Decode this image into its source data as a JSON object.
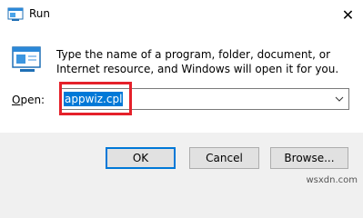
{
  "window": {
    "title": "Run",
    "close_symbol": "✕"
  },
  "icons": {
    "app": "run-icon",
    "close": "close-icon",
    "dropdown": "chevron-down-icon"
  },
  "description": "Type the name of a program, folder, document, or Internet resource, and Windows will open it for you.",
  "open": {
    "label_accel": "O",
    "label_rest": "pen:",
    "value": "appwiz.cpl"
  },
  "buttons": {
    "ok": "OK",
    "cancel": "Cancel",
    "browse": "Browse..."
  },
  "watermark": "wsxdn.com",
  "colors": {
    "selection": "#0078d7",
    "highlight_box": "#e5212a",
    "footer": "#f0f0f0"
  }
}
